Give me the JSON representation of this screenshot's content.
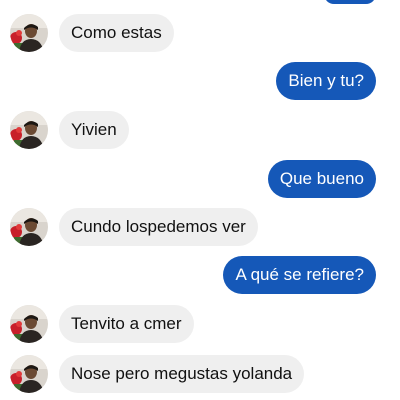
{
  "colors": {
    "incoming_bubble": "#efefef",
    "outgoing_bubble": "#1558b8",
    "incoming_text": "#111111",
    "outgoing_text": "#ffffff"
  },
  "messages": [
    {
      "direction": "incoming",
      "text": "Como estas"
    },
    {
      "direction": "outgoing",
      "text": "Bien y tu?"
    },
    {
      "direction": "incoming",
      "text": "Yivien"
    },
    {
      "direction": "outgoing",
      "text": "Que bueno"
    },
    {
      "direction": "incoming",
      "text": "Cundo lospedemos ver"
    },
    {
      "direction": "outgoing",
      "text": "A qué se refiere?"
    },
    {
      "direction": "incoming",
      "text": "Tenvito a cmer"
    },
    {
      "direction": "incoming",
      "text": "Nose pero megustas yolanda"
    }
  ]
}
